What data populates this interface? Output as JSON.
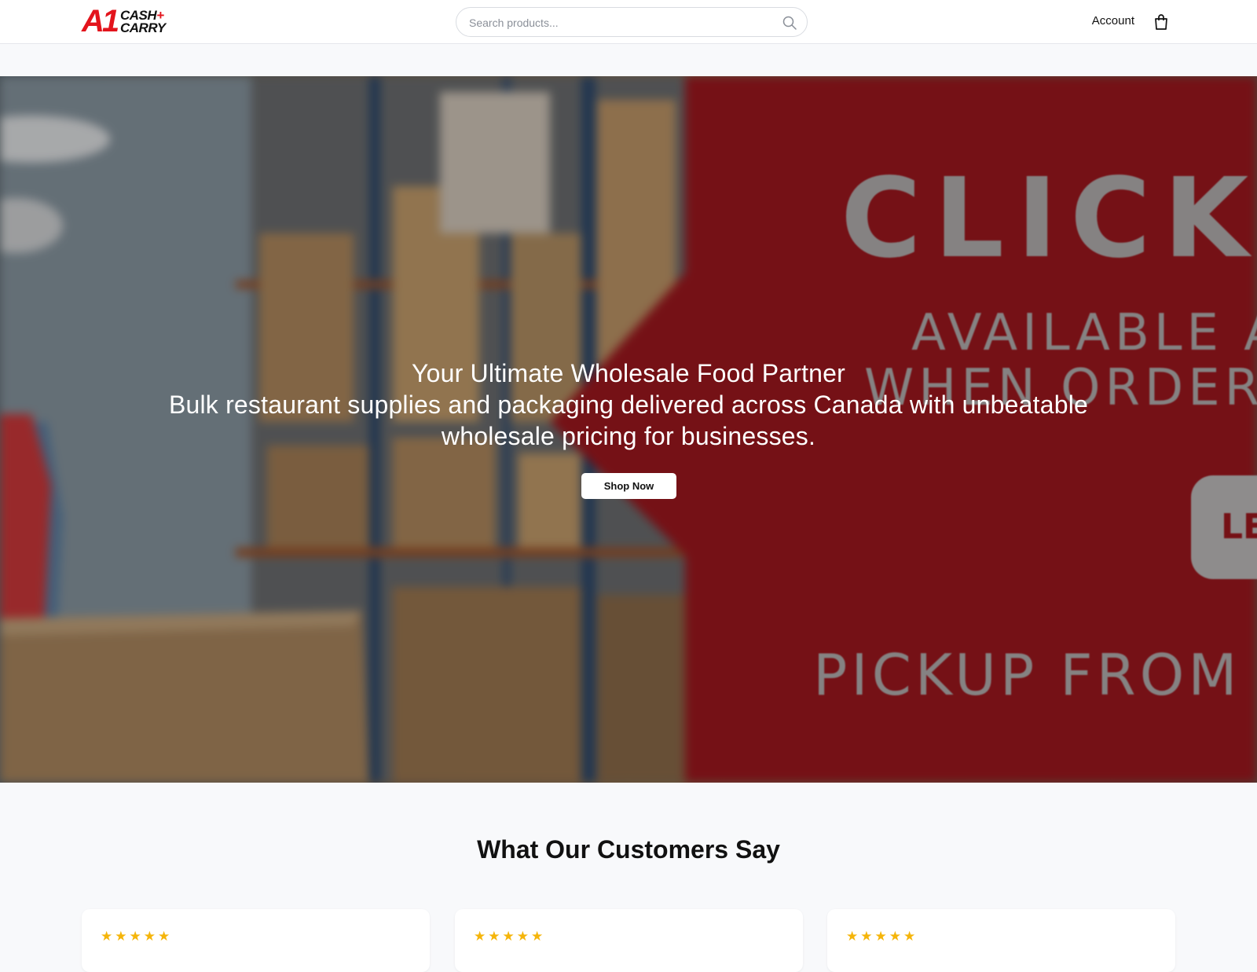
{
  "header": {
    "logo": {
      "line1": "CASH",
      "plus": "+",
      "line2": "CARRY",
      "mark": "A1"
    },
    "search": {
      "placeholder": "Search products...",
      "value": ""
    },
    "account_label": "Account",
    "cart_icon": "shopping-bag-icon"
  },
  "hero": {
    "title": "Your Ultimate Wholesale Food Partner",
    "subtitle": "Bulk restaurant supplies and packaging delivered across Canada with unbeatable wholesale pricing for businesses.",
    "cta_label": "Shop Now",
    "banner": {
      "line1": "CLICK &",
      "line2": "AVAILABLE AS",
      "line3": "WHEN ORDER IS",
      "line4": "LE",
      "line5": "PICKUP FROM MIS"
    },
    "accent_color": "#a3181f"
  },
  "testimonials": {
    "title": "What Our Customers Say",
    "cards": [
      {
        "stars": "★★★★★",
        "rating": 5
      },
      {
        "stars": "★★★★★",
        "rating": 5
      },
      {
        "stars": "★★★★★",
        "rating": 5
      }
    ]
  },
  "colors": {
    "brand_red": "#e3141c",
    "star": "#f5b50a",
    "page_bg": "#f8f9fb"
  }
}
